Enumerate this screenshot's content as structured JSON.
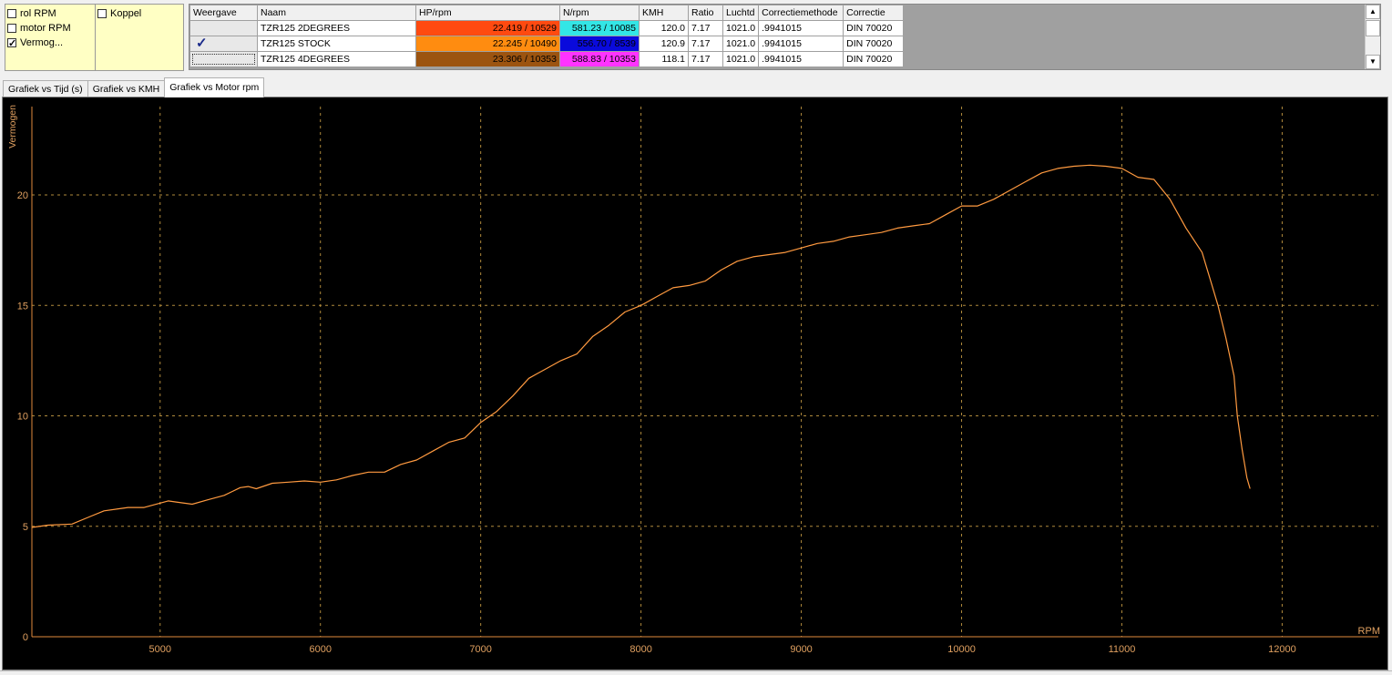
{
  "options": {
    "col1": [
      {
        "label": "rol RPM",
        "checked": false
      },
      {
        "label": "motor RPM",
        "checked": false
      },
      {
        "label": "Vermog...",
        "checked": true
      }
    ],
    "col2": [
      {
        "label": "Koppel",
        "checked": false
      }
    ]
  },
  "runs_table": {
    "headers": [
      "Weergave",
      "Naam",
      "HP/rpm",
      "N/rpm",
      "KMH",
      "Ratio",
      "Luchtd",
      "Correctiemethode",
      "Correctie"
    ],
    "rows": [
      {
        "shown": false,
        "focused": false,
        "name": "TZR125 2DEGREES",
        "hp": "22.419 / 10529",
        "hp_color": "#ff4a10",
        "nm": "581.23 / 10085",
        "nm_color": "#33e6e6",
        "kmh": "120.0",
        "ratio": "7.17",
        "luchtd": "1021.0",
        "method": ".9941015",
        "correctie": "DIN 70020"
      },
      {
        "shown": true,
        "focused": false,
        "name": "TZR125 STOCK",
        "hp": "22.245 / 10490",
        "hp_color": "#ff8c10",
        "nm": "556.70 / 8539",
        "nm_color": "#0a0adc",
        "kmh": "120.9",
        "ratio": "7.17",
        "luchtd": "1021.0",
        "method": ".9941015",
        "correctie": "DIN 70020"
      },
      {
        "shown": false,
        "focused": true,
        "name": "TZR125 4DEGREES",
        "hp": "23.306 / 10353",
        "hp_color": "#9c5410",
        "nm": "588.83 / 10353",
        "nm_color": "#ff33ff",
        "kmh": "118.1",
        "ratio": "7.17",
        "luchtd": "1021.0",
        "method": ".9941015",
        "correctie": "DIN 70020"
      }
    ]
  },
  "tabs": [
    {
      "label": "Grafiek vs Tijd (s)",
      "active": false
    },
    {
      "label": "Grafiek vs KMH",
      "active": false
    },
    {
      "label": "Grafiek vs Motor rpm",
      "active": true
    }
  ],
  "chart_data": {
    "type": "line",
    "ylabel": "Vermogen",
    "xlabel": "RPM",
    "xlim": [
      4200,
      12600
    ],
    "ylim": [
      0,
      24
    ],
    "x_ticks": [
      5000,
      6000,
      7000,
      8000,
      9000,
      10000,
      11000,
      12000
    ],
    "y_ticks": [
      0,
      5,
      10,
      15,
      20
    ],
    "grid": true,
    "colors": {
      "line": "#ff9a40",
      "grid": "#b08a3c",
      "axis": "#e08a3c",
      "text": "#e0a060"
    },
    "series": [
      {
        "x": [
          4200,
          4300,
          4450,
          4550,
          4650,
          4800,
          4900,
          5000,
          5050,
          5100,
          5200,
          5300,
          5400,
          5500,
          5550,
          5600,
          5700,
          5800,
          5900,
          6000,
          6100,
          6200,
          6300,
          6400,
          6500,
          6600,
          6700,
          6800,
          6900,
          7000,
          7100,
          7200,
          7300,
          7350,
          7400,
          7500,
          7600,
          7700,
          7800,
          7900,
          8000,
          8100,
          8200,
          8300,
          8400,
          8500,
          8600,
          8700,
          8800,
          8900,
          9000,
          9100,
          9200,
          9300,
          9400,
          9500,
          9600,
          9700,
          9800,
          9900,
          10000,
          10100,
          10200,
          10300,
          10400,
          10500,
          10600,
          10700,
          10800,
          10900,
          11000,
          11100,
          11200,
          11300,
          11400,
          11500,
          11550,
          11600,
          11650,
          11700,
          11720,
          11750,
          11780,
          11800
        ],
        "y": [
          4.95,
          5.05,
          5.1,
          5.4,
          5.7,
          5.85,
          5.85,
          6.05,
          6.15,
          6.1,
          6.0,
          6.2,
          6.4,
          6.75,
          6.8,
          6.7,
          6.95,
          7.0,
          7.05,
          7.0,
          7.1,
          7.3,
          7.45,
          7.45,
          7.8,
          8.0,
          8.4,
          8.8,
          9.0,
          9.7,
          10.2,
          10.9,
          11.7,
          11.9,
          12.1,
          12.5,
          12.8,
          13.6,
          14.1,
          14.7,
          15.0,
          15.4,
          15.8,
          15.9,
          16.1,
          16.6,
          17.0,
          17.2,
          17.3,
          17.4,
          17.6,
          17.8,
          17.9,
          18.1,
          18.2,
          18.3,
          18.5,
          18.6,
          18.7,
          19.1,
          19.5,
          19.5,
          19.8,
          20.2,
          20.6,
          21.0,
          21.2,
          21.3,
          21.35,
          21.3,
          21.2,
          20.8,
          20.7,
          19.8,
          18.5,
          17.4,
          16.2,
          15.0,
          13.5,
          11.8,
          10.0,
          8.5,
          7.2,
          6.7
        ]
      }
    ]
  }
}
